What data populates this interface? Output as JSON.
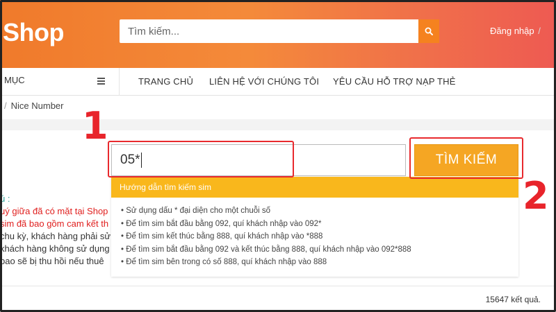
{
  "header": {
    "logo": "Shop",
    "search_placeholder": "Tìm kiếm...",
    "login_label": "Đăng nhập",
    "login_sep": "/"
  },
  "nav": {
    "category_label": "MỤC",
    "links": [
      "TRANG CHỦ",
      "LIÊN HỆ VỚI CHÚNG TÔI",
      "YÊU CẦU HỖ TRỢ NẠP THẺ"
    ]
  },
  "breadcrumb": {
    "current": "Nice Number"
  },
  "left_text": [
    {
      "text": "ú :",
      "color": "#2aa198"
    },
    {
      "text": "uý giữa đã có mặt tại Shop",
      "color": "#e0201f"
    },
    {
      "text": "sim đã bao gồm cam kết th",
      "color": "#e0201f"
    },
    {
      "text": "chu kỳ, khách hàng phải sử",
      "color": "#333333"
    },
    {
      "text": "khách hàng không sử dụng",
      "color": "#333333"
    },
    {
      "text": "bao sẽ bị thu hồi nếu thuê",
      "color": "#333333"
    }
  ],
  "search": {
    "value": "05*",
    "button_label": "TÌM KIẾM"
  },
  "guide": {
    "title": "Hướng dẫn tìm kiếm sim",
    "items": [
      "Sử dụng dấu * đại diện cho một chuỗi số",
      "Để tìm sim bắt đầu bằng 092, quí khách nhập vào 092*",
      "Để tìm sim kết thúc bằng 888, quí khách nhập vào *888",
      "Để tìm sim bắt đầu bằng 092 và kết thúc bằng 888, quí khách nhập vào 092*888",
      "Để tìm sim bên trong có số 888, quí khách nhập vào 888"
    ]
  },
  "results": {
    "count_text": "15647 kết quả."
  },
  "steps": {
    "one": "1",
    "two": "2"
  },
  "colors": {
    "accent_orange": "#f5a623",
    "header_gradient_start": "#f07a2b",
    "header_gradient_end": "#ee5a52",
    "highlight_red": "#e8292d",
    "guide_header": "#f9b71c"
  }
}
